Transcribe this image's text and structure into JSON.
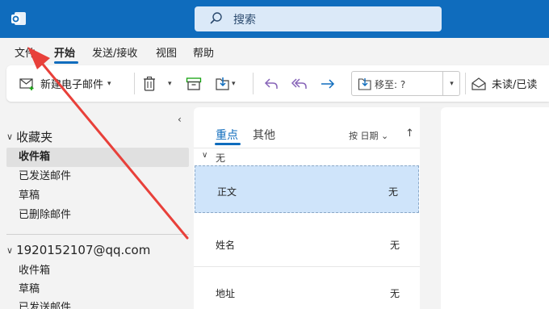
{
  "search": {
    "placeholder": "搜索"
  },
  "menu": {
    "tabs": [
      {
        "label": "文件"
      },
      {
        "label": "开始"
      },
      {
        "label": "发送/接收"
      },
      {
        "label": "视图"
      },
      {
        "label": "帮助"
      }
    ],
    "active": "开始"
  },
  "ribbon": {
    "new_mail": "新建电子邮件",
    "move_to": "移至: ?",
    "unread_read": "未读/已读"
  },
  "folders": {
    "favorites_header": "收藏夹",
    "favorites": [
      {
        "label": "收件箱"
      },
      {
        "label": "已发送邮件"
      },
      {
        "label": "草稿"
      },
      {
        "label": "已删除邮件"
      }
    ],
    "account_header": "1920152107@qq.com",
    "account_items": [
      {
        "label": "收件箱"
      },
      {
        "label": "草稿"
      },
      {
        "label": "已发送邮件"
      }
    ]
  },
  "message_list": {
    "tab_focused": "重点",
    "tab_other": "其他",
    "sort_label": "按 日期",
    "group_label": "无",
    "messages": [
      {
        "subject": "正文",
        "date": "无"
      },
      {
        "subject": "姓名",
        "date": "无"
      },
      {
        "subject": "地址",
        "date": "无"
      }
    ]
  },
  "colors": {
    "accent": "#0f6cbd",
    "annotation_arrow": "#e8403a"
  }
}
